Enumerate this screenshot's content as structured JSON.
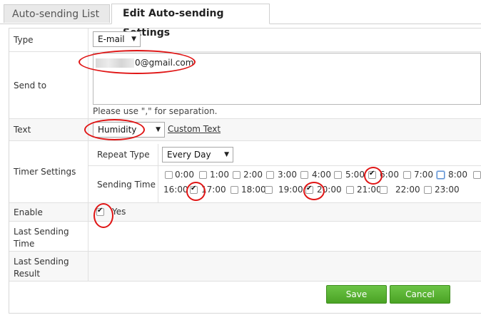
{
  "tabs": {
    "list": "Auto-sending List",
    "edit": "Edit Auto-sending Settings"
  },
  "form": {
    "type": {
      "label": "Type",
      "value": "E-mail"
    },
    "send_to": {
      "label": "Send to",
      "email_suffix": "0@gmail.com",
      "hint": "Please use \",\" for separation."
    },
    "text": {
      "label": "Text",
      "value": "Humidity",
      "custom_link": "Custom Text"
    },
    "timer": {
      "label": "Timer Settings",
      "repeat_label": "Repeat Type",
      "repeat_value": "Every Day",
      "sending_label": "Sending Time",
      "hours": [
        {
          "label": "0:00",
          "checked": false
        },
        {
          "label": "1:00",
          "checked": false
        },
        {
          "label": "2:00",
          "checked": false
        },
        {
          "label": "3:00",
          "checked": false
        },
        {
          "label": "4:00",
          "checked": false
        },
        {
          "label": "5:00",
          "checked": false
        },
        {
          "label": "6:00",
          "checked": true
        },
        {
          "label": "7:00",
          "checked": false
        },
        {
          "label": "8:00",
          "checked": false
        },
        {
          "label": "16:00",
          "checked": false
        },
        {
          "label": "17:00",
          "checked": true
        },
        {
          "label": "18:00",
          "checked": false
        },
        {
          "label": "19:00",
          "checked": false
        },
        {
          "label": "20:00",
          "checked": true
        },
        {
          "label": "21:00",
          "checked": false
        },
        {
          "label": "22:00",
          "checked": false
        },
        {
          "label": "23:00",
          "checked": false
        }
      ]
    },
    "enable": {
      "label": "Enable",
      "option": "Yes",
      "checked": true
    },
    "last_time": {
      "label1": "Last Sending",
      "label2": "Time"
    },
    "last_result": {
      "label1": "Last Sending",
      "label2": "Result"
    }
  },
  "buttons": {
    "save": "Save",
    "cancel": "Cancel"
  },
  "colors": {
    "highlight_ring": "#e01515",
    "button_green": "#4aa324"
  }
}
